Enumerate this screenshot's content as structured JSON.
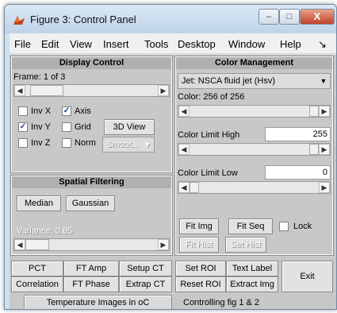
{
  "window": {
    "title": "Figure 3: Control Panel",
    "min_glyph": "–",
    "max_glyph": "□",
    "close_glyph": "X"
  },
  "menu": {
    "items": [
      "File",
      "Edit",
      "View",
      "Insert",
      "Tools",
      "Desktop",
      "Window",
      "Help",
      "↘"
    ]
  },
  "display_control": {
    "title": "Display Control",
    "frame_label": "Frame: 1 of 3",
    "frame_fraction": 0.05,
    "inv_x": {
      "label": "Inv X",
      "checked": false
    },
    "axis": {
      "label": "Axis",
      "checked": true
    },
    "inv_y": {
      "label": "Inv Y",
      "checked": true
    },
    "grid": {
      "label": "Grid",
      "checked": false
    },
    "inv_z": {
      "label": "Inv Z",
      "checked": false
    },
    "norm": {
      "label": "Norm",
      "checked": false
    },
    "view3d_label": "3D View",
    "smooth_value": "Smoot..."
  },
  "spatial_filtering": {
    "title": "Spatial Filtering",
    "median_label": "Median",
    "gaussian_label": "Gaussian",
    "variance_label": "Variance: 0.85"
  },
  "color_management": {
    "title": "Color Management",
    "colormap_value": "Jet: NSCA fluid jet (Hsv)",
    "color_label": "Color: 256 of 256",
    "color_fraction": 1.0,
    "limit_high_label": "Color Limit High",
    "limit_high_value": "255",
    "limit_high_fraction": 1.0,
    "limit_low_label": "Color Limit Low",
    "limit_low_value": "0",
    "limit_low_fraction": 0.0,
    "fit_img_label": "Fit Img",
    "fit_seq_label": "Fit Seq",
    "lock_label": "Lock",
    "lock_checked": false,
    "fit_hist_label": "Fit Hist",
    "set_hist_label": "Set Hist"
  },
  "bottom": {
    "pct": "PCT",
    "ft_amp": "FT Amp",
    "setup_ct": "Setup CT",
    "correlation": "Correlation",
    "ft_phase": "FT Phase",
    "extrap_ct": "Extrap CT",
    "set_roi": "Set ROI",
    "text_label": "Text Label",
    "reset_roi": "Reset ROI",
    "extract_img": "Extract Img",
    "exit": "Exit",
    "status_left": "Temperature Images in oC",
    "status_right": "Controlling fig 1 & 2"
  },
  "glyphs": {
    "left": "◀",
    "right": "▶",
    "down": "▼",
    "check": "✓"
  }
}
